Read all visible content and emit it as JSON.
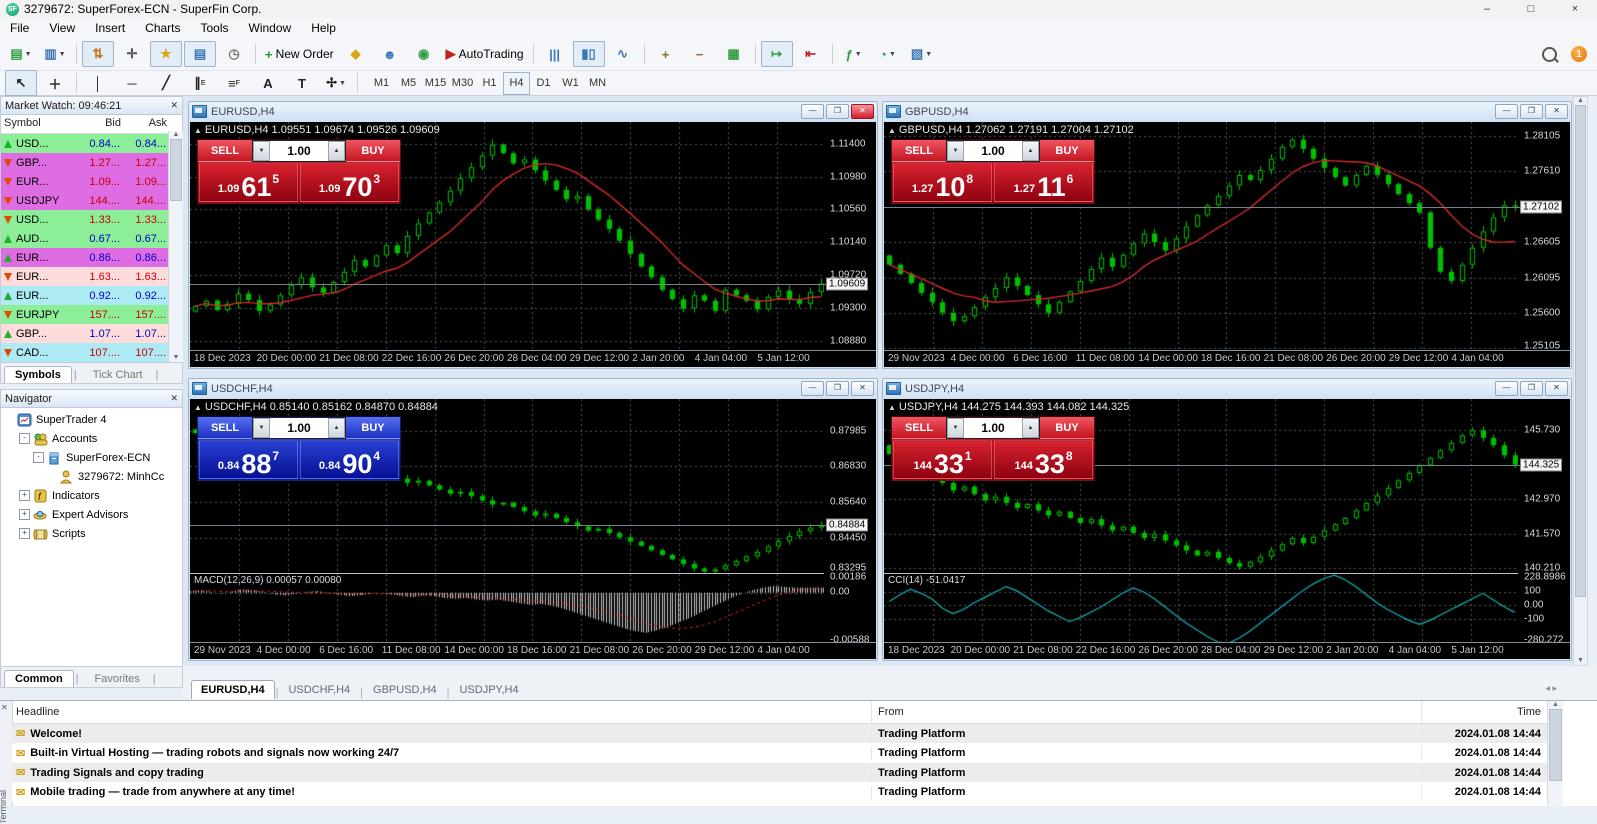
{
  "titlebar": {
    "logo_text": "SF",
    "app_title": "3279672: SuperForex-ECN - SuperFin Corp.",
    "controls": [
      "–",
      "□",
      "×"
    ]
  },
  "menu": [
    "File",
    "View",
    "Insert",
    "Charts",
    "Tools",
    "Window",
    "Help"
  ],
  "toolbar": {
    "row1": [
      {
        "name": "new-chart-button",
        "glyph": "▤",
        "color": "#2f9e3f",
        "dropdown": true
      },
      {
        "name": "profiles-button",
        "glyph": "▥",
        "color": "#3b76b8",
        "dropdown": true
      },
      {
        "type": "sep"
      },
      {
        "name": "market-watch-toggle",
        "glyph": "⇅",
        "color": "#d07010",
        "pressed": true
      },
      {
        "name": "data-window-toggle",
        "glyph": "✛",
        "color": "#555555"
      },
      {
        "name": "navigator-toggle",
        "glyph": "★",
        "color": "#d8a718",
        "pressed": true
      },
      {
        "name": "terminal-toggle",
        "glyph": "▤",
        "color": "#3b76b8",
        "pressed": true
      },
      {
        "name": "strategy-tester-toggle",
        "glyph": "◷",
        "color": "#777777"
      },
      {
        "type": "sep"
      },
      {
        "name": "new-order-button",
        "glyph": "+",
        "color": "#1f9e2f",
        "label": "New Order"
      },
      {
        "name": "metaeditor-button",
        "glyph": "◆",
        "color": "#d8a718"
      },
      {
        "name": "experts-button",
        "glyph": "☻",
        "color": "#3b76b8"
      },
      {
        "name": "signals-button",
        "glyph": "◉",
        "color": "#2f9e3f"
      },
      {
        "name": "autotrading-button",
        "glyph": "▶",
        "color": "#c42020",
        "label": "AutoTrading"
      },
      {
        "type": "sep"
      },
      {
        "name": "bar-chart-button",
        "glyph": "|||",
        "color": "#3b76b8"
      },
      {
        "name": "candle-chart-button",
        "glyph": "▮▯",
        "color": "#3b76b8",
        "pressed": true
      },
      {
        "name": "line-chart-button",
        "glyph": "∿",
        "color": "#3b76b8"
      },
      {
        "type": "sep"
      },
      {
        "name": "zoom-in-button",
        "glyph": "+",
        "color": "#8a6d1a"
      },
      {
        "name": "zoom-out-button",
        "glyph": "−",
        "color": "#8a6d1a"
      },
      {
        "name": "tile-windows-button",
        "glyph": "▦",
        "color": "#2f9e3f"
      },
      {
        "type": "sep"
      },
      {
        "name": "auto-scroll-toggle",
        "glyph": "↦",
        "color": "#2f9e3f",
        "pressed": true
      },
      {
        "name": "chart-shift-toggle",
        "glyph": "⇤",
        "color": "#c42020"
      },
      {
        "type": "sep"
      },
      {
        "name": "indicators-button",
        "glyph": "ƒ",
        "color": "#2f9e3f",
        "dropdown": true
      },
      {
        "name": "periods-button",
        "glyph": "◔",
        "color": "#3b76b8",
        "dropdown": true
      },
      {
        "name": "templates-button",
        "glyph": "▧",
        "color": "#3b76b8",
        "dropdown": true
      }
    ],
    "row2": [
      {
        "name": "cursor-tool",
        "glyph": "↖",
        "color": "#222222",
        "pressed": true
      },
      {
        "name": "crosshair-tool",
        "glyph": "＋",
        "color": "#222222"
      },
      {
        "type": "sep"
      },
      {
        "name": "vline-tool",
        "glyph": "│",
        "color": "#222222"
      },
      {
        "name": "hline-tool",
        "glyph": "─",
        "color": "#222222"
      },
      {
        "name": "trendline-tool",
        "glyph": "╱",
        "color": "#222222"
      },
      {
        "name": "channel-tool",
        "glyph": "∥",
        "color": "#222222",
        "sub": "E"
      },
      {
        "name": "fibonacci-tool",
        "glyph": "≡",
        "color": "#222222",
        "sub": "F"
      },
      {
        "name": "text-tool",
        "glyph": "A",
        "color": "#222222"
      },
      {
        "name": "label-tool",
        "glyph": "T",
        "color": "#222222"
      },
      {
        "name": "shapes-tool",
        "glyph": "✢",
        "color": "#222222",
        "dropdown": true
      },
      {
        "type": "sep"
      }
    ],
    "timeframes": [
      "M1",
      "M5",
      "M15",
      "M30",
      "H1",
      "H4",
      "D1",
      "W1",
      "MN"
    ],
    "active_timeframe": "H4",
    "badge_count": "1"
  },
  "market_watch": {
    "title": "Market Watch: 09:46:21",
    "columns": [
      "Symbol",
      "Bid",
      "Ask"
    ],
    "rows": [
      {
        "dir": "up",
        "symbol": "USD...",
        "bid": "0.84...",
        "ask": "0.84...",
        "bg": "#8cee96",
        "txt": "#0000cc"
      },
      {
        "dir": "down",
        "symbol": "GBP...",
        "bid": "1.27...",
        "ask": "1.27...",
        "bg": "#de6ce2",
        "txt": "#cc0000"
      },
      {
        "dir": "down",
        "symbol": "EUR...",
        "bid": "1.09...",
        "ask": "1.09...",
        "bg": "#de6ce2",
        "txt": "#cc0000"
      },
      {
        "dir": "down",
        "symbol": "USDJPY",
        "bid": "144....",
        "ask": "144....",
        "bg": "#de6ce2",
        "txt": "#cc0000"
      },
      {
        "dir": "down",
        "symbol": "USD...",
        "bid": "1.33...",
        "ask": "1.33...",
        "bg": "#8cee96",
        "txt": "#cc0000"
      },
      {
        "dir": "up",
        "symbol": "AUD...",
        "bid": "0.67...",
        "ask": "0.67...",
        "bg": "#8cee96",
        "txt": "#0000cc"
      },
      {
        "dir": "up",
        "symbol": "EUR...",
        "bid": "0.86...",
        "ask": "0.86...",
        "bg": "#de6ce2",
        "txt": "#0000cc"
      },
      {
        "dir": "down",
        "symbol": "EUR...",
        "bid": "1.63...",
        "ask": "1.63...",
        "bg": "#ffdcdc",
        "txt": "#cc0000"
      },
      {
        "dir": "up",
        "symbol": "EUR...",
        "bid": "0.92...",
        "ask": "0.92...",
        "bg": "#aeeaf4",
        "txt": "#0000cc"
      },
      {
        "dir": "down",
        "symbol": "EURJPY",
        "bid": "157....",
        "ask": "157....",
        "bg": "#8cee96",
        "txt": "#cc0000"
      },
      {
        "dir": "up",
        "symbol": "GBP...",
        "bid": "1.07...",
        "ask": "1.07...",
        "bg": "#ffdcdc",
        "txt": "#0000cc"
      },
      {
        "dir": "down",
        "symbol": "CAD...",
        "bid": "107....",
        "ask": "107....",
        "bg": "#aeeaf4",
        "txt": "#cc0000"
      }
    ],
    "tabs": [
      "Symbols",
      "Tick Chart"
    ]
  },
  "navigator": {
    "title": "Navigator",
    "tree": [
      {
        "label": "SuperTrader 4",
        "icon": "platform",
        "indent": 0,
        "expand": ""
      },
      {
        "label": "Accounts",
        "icon": "accounts",
        "indent": 1,
        "expand": "-"
      },
      {
        "label": "SuperForex-ECN",
        "icon": "server",
        "indent": 2,
        "expand": "-"
      },
      {
        "label": "3279672: MinhCc",
        "icon": "user",
        "indent": 3,
        "expand": ""
      },
      {
        "label": "Indicators",
        "icon": "indicators",
        "indent": 1,
        "expand": "+"
      },
      {
        "label": "Expert Advisors",
        "icon": "experts",
        "indent": 1,
        "expand": "+"
      },
      {
        "label": "Scripts",
        "icon": "scripts",
        "indent": 1,
        "expand": "+"
      }
    ],
    "tabs": [
      "Common",
      "Favorites"
    ]
  },
  "charts": [
    {
      "window_title": "EURUSD,H4",
      "info": "EURUSD,H4  1.09551 1.09674 1.09526 1.09609",
      "active": true,
      "panel": {
        "color": "red",
        "sell_label": "SELL",
        "buy_label": "BUY",
        "volume": "1.00",
        "sell_prefix": "1.09",
        "sell_big": "61",
        "sell_sup": "5",
        "buy_prefix": "1.09",
        "buy_big": "70",
        "buy_sup": "3"
      },
      "ylim": [
        1.0872,
        1.1168
      ],
      "ticks": [
        "1.11400",
        "1.10980",
        "1.10560",
        "1.10140",
        "1.09720",
        "1.09300",
        "1.08880"
      ],
      "current": "1.09609",
      "ma": true,
      "dates": [
        "18 Dec 2023",
        "20 Dec 00:00",
        "21 Dec 08:00",
        "22 Dec 16:00",
        "26 Dec 20:00",
        "28 Dec 04:00",
        "29 Dec 12:00",
        "2 Jan 20:00",
        "4 Jan 04:00",
        "5 Jan 12:00"
      ],
      "closes": [
        1.0932,
        1.0939,
        1.0927,
        1.0935,
        1.0948,
        1.094,
        1.0926,
        1.0934,
        1.0946,
        1.0959,
        1.0969,
        1.0956,
        1.0949,
        1.0963,
        1.0976,
        1.0991,
        1.0983,
        1.0997,
        1.101,
        1.1,
        1.1022,
        1.1038,
        1.1052,
        1.1065,
        1.108,
        1.1096,
        1.111,
        1.1125,
        1.1139,
        1.1128,
        1.1115,
        1.112,
        1.1106,
        1.1093,
        1.1081,
        1.1069,
        1.1073,
        1.1056,
        1.1043,
        1.1031,
        1.1016,
        1.0999,
        1.0983,
        1.0969,
        1.0953,
        1.0941,
        1.0929,
        1.0946,
        1.0939,
        1.0926,
        1.0953,
        1.0946,
        1.0939,
        1.0928,
        1.0944,
        1.0952,
        1.0941,
        1.0935,
        1.095,
        1.0961
      ],
      "sub": null
    },
    {
      "window_title": "GBPUSD,H4",
      "info": "GBPUSD,H4  1.27062 1.27191 1.27004 1.27102",
      "active": false,
      "panel": {
        "color": "red",
        "sell_label": "SELL",
        "buy_label": "BUY",
        "volume": "1.00",
        "sell_prefix": "1.27",
        "sell_big": "10",
        "sell_sup": "8",
        "buy_prefix": "1.27",
        "buy_big": "11",
        "buy_sup": "6"
      },
      "ylim": [
        1.2503,
        1.283
      ],
      "ticks": [
        "1.28105",
        "1.27610",
        "1.26605",
        "1.26095",
        "1.25600",
        "1.25105"
      ],
      "current": "1.27102",
      "ma": true,
      "dates": [
        "29 Nov 2023",
        "4 Dec 00:00",
        "6 Dec 16:00",
        "11 Dec 08:00",
        "14 Dec 00:00",
        "18 Dec 16:00",
        "21 Dec 08:00",
        "26 Dec 20:00",
        "29 Dec 12:00",
        "4 Jan 04:00"
      ],
      "closes": [
        1.2628,
        1.2615,
        1.2602,
        1.2588,
        1.2575,
        1.256,
        1.2548,
        1.2555,
        1.2568,
        1.2582,
        1.2595,
        1.261,
        1.2598,
        1.2585,
        1.2572,
        1.256,
        1.2575,
        1.259,
        1.2605,
        1.2622,
        1.2638,
        1.2625,
        1.2642,
        1.2658,
        1.2672,
        1.266,
        1.2648,
        1.2665,
        1.2682,
        1.2698,
        1.2712,
        1.2725,
        1.274,
        1.2755,
        1.2748,
        1.2762,
        1.2778,
        1.2795,
        1.2805,
        1.2792,
        1.2778,
        1.2765,
        1.2752,
        1.274,
        1.2755,
        1.2768,
        1.2755,
        1.2742,
        1.2728,
        1.2715,
        1.2702,
        1.2652,
        1.2618,
        1.2605,
        1.2628,
        1.2652,
        1.2675,
        1.2695,
        1.2712,
        1.271
      ],
      "sub": null
    },
    {
      "window_title": "USDCHF,H4",
      "info": "USDCHF,H4  0.85140 0.85162 0.84870 0.84884",
      "active": false,
      "panel": {
        "color": "blue",
        "sell_label": "SELL",
        "buy_label": "BUY",
        "volume": "1.00",
        "sell_prefix": "0.84",
        "sell_big": "88",
        "sell_sup": "7",
        "buy_prefix": "0.84",
        "buy_big": "90",
        "buy_sup": "4"
      },
      "ylim": [
        0.833,
        0.8905
      ],
      "ticks": [
        "0.87985",
        "0.86830",
        "0.85640",
        "0.84450",
        "0.83295"
      ],
      "current": "0.84884",
      "ma": false,
      "dates": [
        "29 Nov 2023",
        "4 Dec 00:00",
        "6 Dec 16:00",
        "11 Dec 08:00",
        "14 Dec 00:00",
        "18 Dec 16:00",
        "21 Dec 08:00",
        "26 Dec 20:00",
        "29 Dec 12:00",
        "4 Jan 04:00"
      ],
      "closes": [
        0.8792,
        0.878,
        0.8768,
        0.8775,
        0.8762,
        0.8748,
        0.8755,
        0.8742,
        0.8728,
        0.8715,
        0.8722,
        0.8708,
        0.8695,
        0.8682,
        0.869,
        0.8676,
        0.8662,
        0.8648,
        0.8655,
        0.8642,
        0.8628,
        0.8635,
        0.862,
        0.8606,
        0.8592,
        0.8598,
        0.8584,
        0.857,
        0.8556,
        0.8562,
        0.8548,
        0.8534,
        0.852,
        0.8526,
        0.8512,
        0.8498,
        0.8484,
        0.847,
        0.8476,
        0.8462,
        0.8448,
        0.8434,
        0.842,
        0.8405,
        0.839,
        0.8375,
        0.836,
        0.8345,
        0.8335,
        0.8342,
        0.8355,
        0.837,
        0.8385,
        0.84,
        0.8418,
        0.8435,
        0.8452,
        0.8468,
        0.848,
        0.8488
      ],
      "sub": {
        "type": "macd",
        "label": "MACD(12,26,9) 0.00057 0.00080",
        "ylim": [
          -0.006,
          0.0022
        ],
        "ticks": [
          "0.00186",
          "0.00",
          "-0.00588"
        ],
        "levels": [
          0
        ],
        "values": [
          0.0002,
          0.0003,
          0.0001,
          -0.0001,
          0.0002,
          0.0004,
          0.0003,
          0.0001,
          -0.0002,
          -0.0003,
          -0.0001,
          0.0001,
          0.0002,
          0.0,
          -0.0002,
          -0.0004,
          -0.0003,
          -0.0001,
          0.0,
          -0.0002,
          -0.0004,
          -0.0005,
          -0.0003,
          -0.0004,
          -0.0006,
          -0.0007,
          -0.0006,
          -0.0008,
          -0.0009,
          -0.0008,
          -0.001,
          -0.0012,
          -0.0014,
          -0.0013,
          -0.0015,
          -0.0018,
          -0.0022,
          -0.0026,
          -0.003,
          -0.0034,
          -0.0038,
          -0.0042,
          -0.0045,
          -0.0047,
          -0.0044,
          -0.004,
          -0.0035,
          -0.003,
          -0.0024,
          -0.0018,
          -0.0012,
          -0.0006,
          -0.0001,
          0.0003,
          0.0006,
          0.0008,
          0.0007,
          0.0006,
          0.0006,
          0.0006
        ]
      }
    },
    {
      "window_title": "USDJPY,H4",
      "info": "USDJPY,H4  144.275 144.393 144.082 144.325",
      "active": false,
      "panel": {
        "color": "red",
        "sell_label": "SELL",
        "buy_label": "BUY",
        "volume": "1.00",
        "sell_prefix": "144",
        "sell_big": "33",
        "sell_sup": "1",
        "buy_prefix": "144",
        "buy_big": "33",
        "buy_sup": "8"
      },
      "ylim": [
        140.0,
        146.95
      ],
      "ticks": [
        "145.730",
        "142.970",
        "141.570",
        "140.210"
      ],
      "current": "144.325",
      "ma": false,
      "dates": [
        "18 Dec 2023",
        "20 Dec 00:00",
        "21 Dec 08:00",
        "22 Dec 16:00",
        "26 Dec 20:00",
        "28 Dec 04:00",
        "29 Dec 12:00",
        "2 Jan 20:00",
        "4 Jan 04:00",
        "5 Jan 12:00"
      ],
      "closes": [
        144.75,
        144.4,
        144.1,
        143.8,
        143.95,
        143.6,
        143.3,
        143.45,
        143.15,
        142.9,
        143.05,
        142.8,
        142.6,
        142.75,
        142.5,
        142.3,
        142.45,
        142.2,
        142.0,
        142.15,
        141.9,
        141.7,
        141.85,
        141.6,
        141.4,
        141.55,
        141.3,
        141.1,
        140.9,
        140.7,
        140.85,
        140.6,
        140.4,
        140.25,
        140.45,
        140.65,
        140.9,
        141.15,
        141.4,
        141.2,
        141.45,
        141.7,
        141.95,
        142.2,
        142.5,
        142.8,
        143.1,
        143.4,
        143.7,
        144.0,
        144.3,
        144.6,
        144.9,
        145.2,
        145.5,
        145.7,
        145.4,
        145.1,
        144.7,
        144.325
      ],
      "sub": {
        "type": "cci",
        "label": "CCI(14) -51.0417",
        "ylim": [
          -285,
          233
        ],
        "ticks": [
          "228.8986",
          "100",
          "0.00",
          "-100",
          "-280.272"
        ],
        "levels": [
          100,
          0,
          -100
        ],
        "values": [
          30,
          80,
          120,
          90,
          50,
          -20,
          -60,
          -30,
          20,
          60,
          100,
          140,
          110,
          60,
          10,
          -40,
          -80,
          -120,
          -90,
          -50,
          -10,
          40,
          90,
          130,
          100,
          50,
          -10,
          -70,
          -130,
          -180,
          -230,
          -270,
          -280,
          -240,
          -190,
          -130,
          -70,
          -10,
          50,
          110,
          160,
          200,
          225,
          190,
          140,
          80,
          20,
          -30,
          -70,
          -110,
          -140,
          -110,
          -70,
          -30,
          10,
          50,
          90,
          40,
          -10,
          -51
        ]
      }
    }
  ],
  "chart_tabs": {
    "items": [
      "EURUSD,H4",
      "USDCHF,H4",
      "GBPUSD,H4",
      "USDJPY,H4"
    ],
    "active": 0
  },
  "terminal": {
    "vertical_label": "Terminal",
    "columns": [
      "Headline",
      "From",
      "Time"
    ],
    "rows": [
      {
        "headline": "Welcome!",
        "from": "Trading Platform",
        "time": "2024.01.08 14:44"
      },
      {
        "headline": "Built-in Virtual Hosting — trading robots and signals now working 24/7",
        "from": "Trading Platform",
        "time": "2024.01.08 14:44"
      },
      {
        "headline": "Trading Signals and copy trading",
        "from": "Trading Platform",
        "time": "2024.01.08 14:44"
      },
      {
        "headline": "Mobile trading — trade from anywhere at any time!",
        "from": "Trading Platform",
        "time": "2024.01.08 14:44"
      }
    ]
  },
  "colors": {
    "candle": "#00c000",
    "ma_line": "#d42a2a",
    "cci_line": "#17b0b8",
    "macd_hist": "#c8c8c8",
    "macd_signal": "#cc2222",
    "chart_bg": "#000000",
    "grid": "#4c5257"
  }
}
